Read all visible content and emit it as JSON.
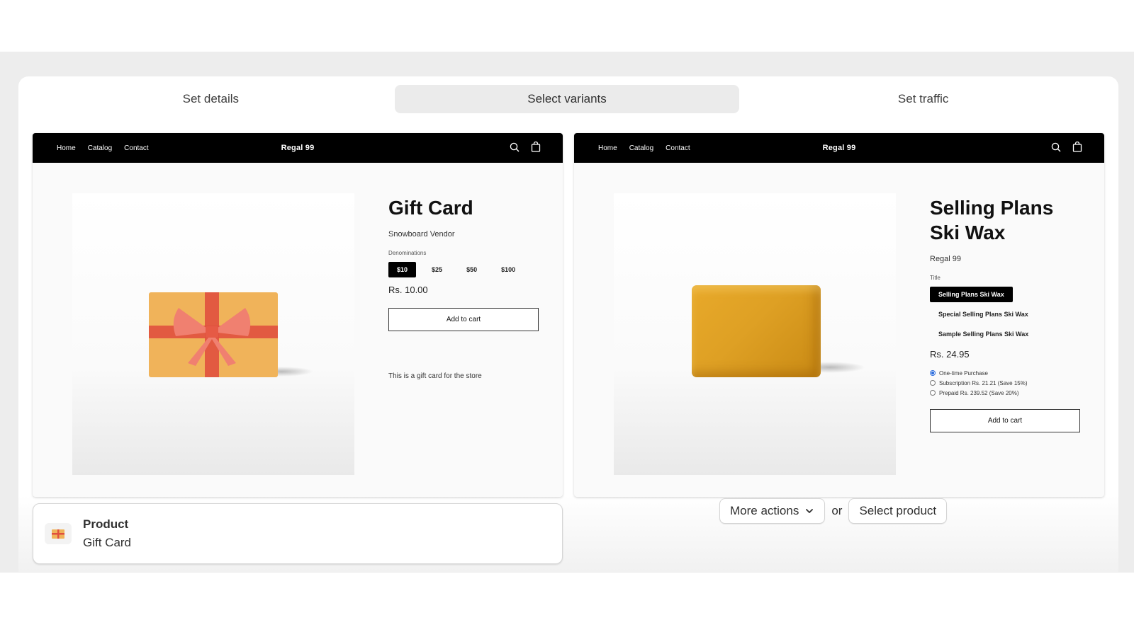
{
  "stepper": {
    "steps": [
      {
        "label": "Set details"
      },
      {
        "label": "Select variants",
        "active": true
      },
      {
        "label": "Set traffic"
      }
    ]
  },
  "previews": {
    "left": {
      "nav": {
        "links": [
          "Home",
          "Catalog",
          "Contact"
        ],
        "brand": "Regal 99"
      },
      "product": {
        "title": "Gift Card",
        "vendor": "Snowboard Vendor",
        "option_label": "Denominations",
        "options": [
          "$10",
          "$25",
          "$50",
          "$100"
        ],
        "selected_option": "$10",
        "price": "Rs. 10.00",
        "add_to_cart": "Add to cart",
        "description": "This is a gift card for the store"
      }
    },
    "right": {
      "nav": {
        "links": [
          "Home",
          "Catalog",
          "Contact"
        ],
        "brand": "Regal 99"
      },
      "product": {
        "title": "Selling Plans Ski Wax",
        "vendor": "Regal 99",
        "option_label": "Title",
        "options": [
          "Selling Plans Ski Wax",
          "Special Selling Plans Ski Wax",
          "Sample Selling Plans Ski Wax"
        ],
        "selected_option": "Selling Plans Ski Wax",
        "price": "Rs. 24.95",
        "purchase_options": [
          "One-time Purchase",
          "Subscription Rs. 21.21 (Save 15%)",
          "Prepaid Rs. 239.52 (Save 20%)"
        ],
        "selected_purchase_option": "One-time Purchase",
        "add_to_cart": "Add to cart"
      }
    }
  },
  "product_field": {
    "label": "Product",
    "value": "Gift Card"
  },
  "actions": {
    "more_actions": "More actions",
    "or": "or",
    "select_product": "Select product"
  },
  "icons": {
    "search": "search-icon",
    "cart": "cart-icon",
    "chevron": "chevron-down-icon",
    "thumb": "gift-card-thumbnail-icon"
  },
  "colors": {
    "navbar": "#000000",
    "gift_box": "#F0B35A",
    "gift_ribbon": "#E0503E",
    "wax": "#DEA024",
    "active_step": "#EBEBEB"
  }
}
